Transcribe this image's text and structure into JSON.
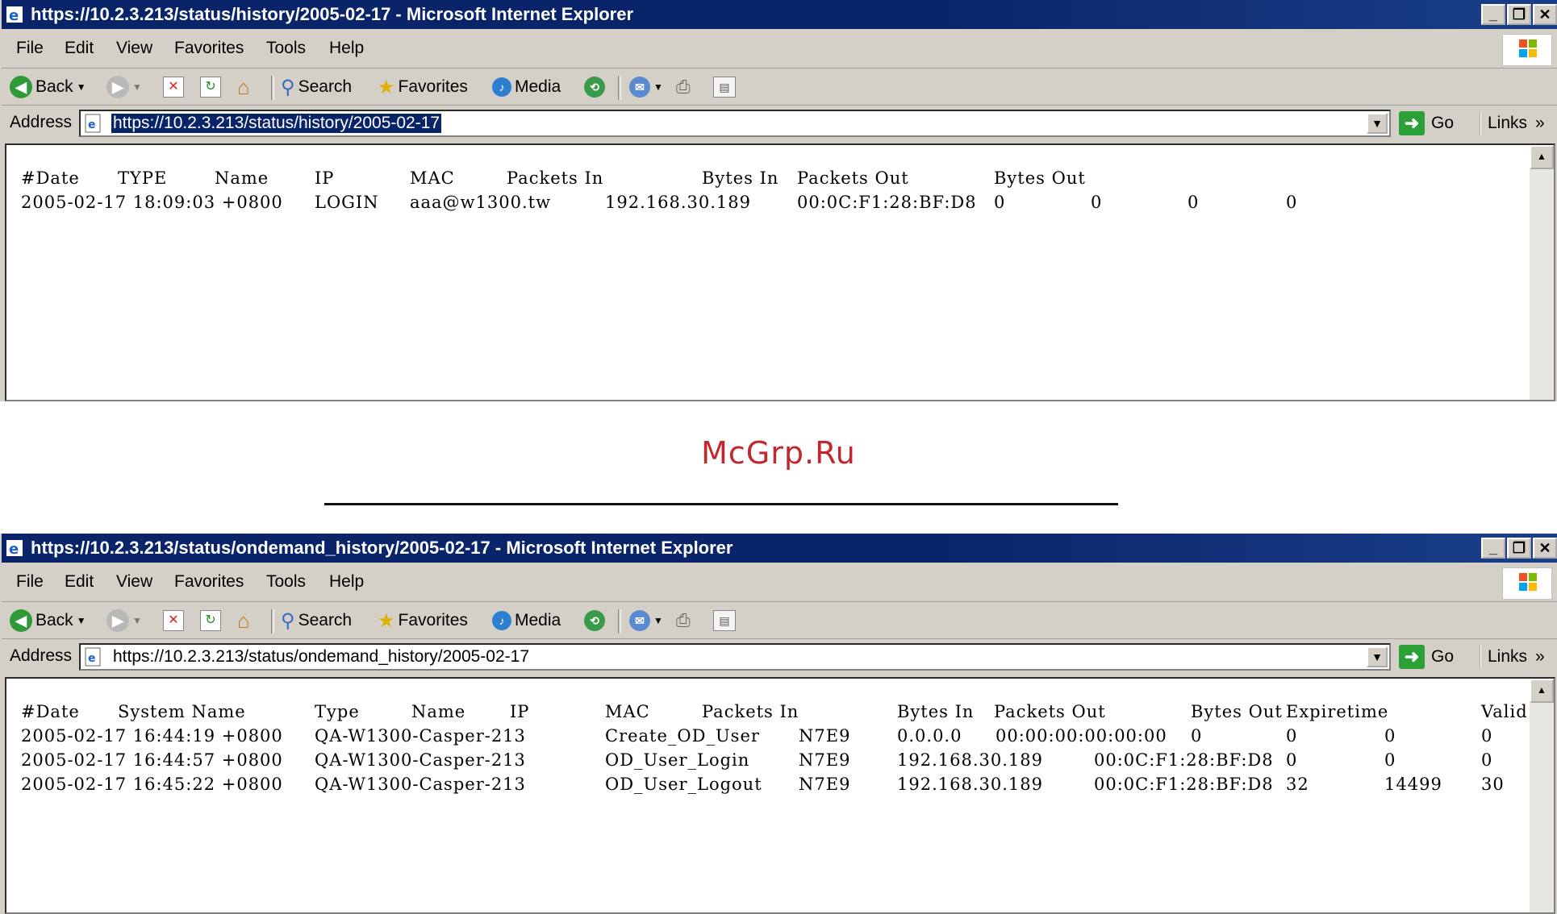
{
  "watermark": "McGrp.Ru",
  "menu": {
    "file": "File",
    "edit": "Edit",
    "view": "View",
    "favorites": "Favorites",
    "tools": "Tools",
    "help": "Help"
  },
  "toolbar": {
    "back": "Back",
    "search": "Search",
    "favorites": "Favorites",
    "media": "Media"
  },
  "address": {
    "label": "Address",
    "go": "Go",
    "links": "Links"
  },
  "window1": {
    "title": "https://10.2.3.213/status/history/2005-02-17 - Microsoft Internet Explorer",
    "url": "https://10.2.3.213/status/history/2005-02-17",
    "header": [
      "#Date",
      "TYPE",
      "Name",
      "IP",
      "MAC",
      "Packets In",
      "Bytes In",
      "Packets Out",
      "Bytes Out"
    ],
    "rows": [
      [
        "2005-02-17 18:09:03 +0800",
        "LOGIN",
        "aaa@w1300.tw",
        "192.168.30.189",
        "00:0C:F1:28:BF:D8",
        "0",
        "0",
        "0",
        "0"
      ]
    ]
  },
  "window2": {
    "title": "https://10.2.3.213/status/ondemand_history/2005-02-17 - Microsoft Internet Explorer",
    "url": "https://10.2.3.213/status/ondemand_history/2005-02-17",
    "header": [
      "#Date",
      "System Name",
      "Type",
      "Name",
      "IP",
      "MAC",
      "Packets In",
      "Bytes In",
      "Packets Out",
      "Bytes Out",
      "Expiretime",
      "Valid"
    ],
    "rows": [
      [
        "2005-02-17 16:44:19 +0800",
        "QA-W1300-Casper-213",
        "Create_OD_User",
        "N7E9",
        "0.0.0.0",
        "00:00:00:00:00:00",
        "0",
        "0",
        "0",
        "0"
      ],
      [
        "2005-02-17 16:44:57 +0800",
        "QA-W1300-Casper-213",
        "OD_User_Login",
        "N7E9",
        "192.168.30.189",
        "00:0C:F1:28:BF:D8",
        "0",
        "0",
        "0"
      ],
      [
        "2005-02-17 16:45:22 +0800",
        "QA-W1300-Casper-213",
        "OD_User_Logout",
        "N7E9",
        "192.168.30.189",
        "00:0C:F1:28:BF:D8",
        "32",
        "14499",
        "30"
      ]
    ]
  }
}
